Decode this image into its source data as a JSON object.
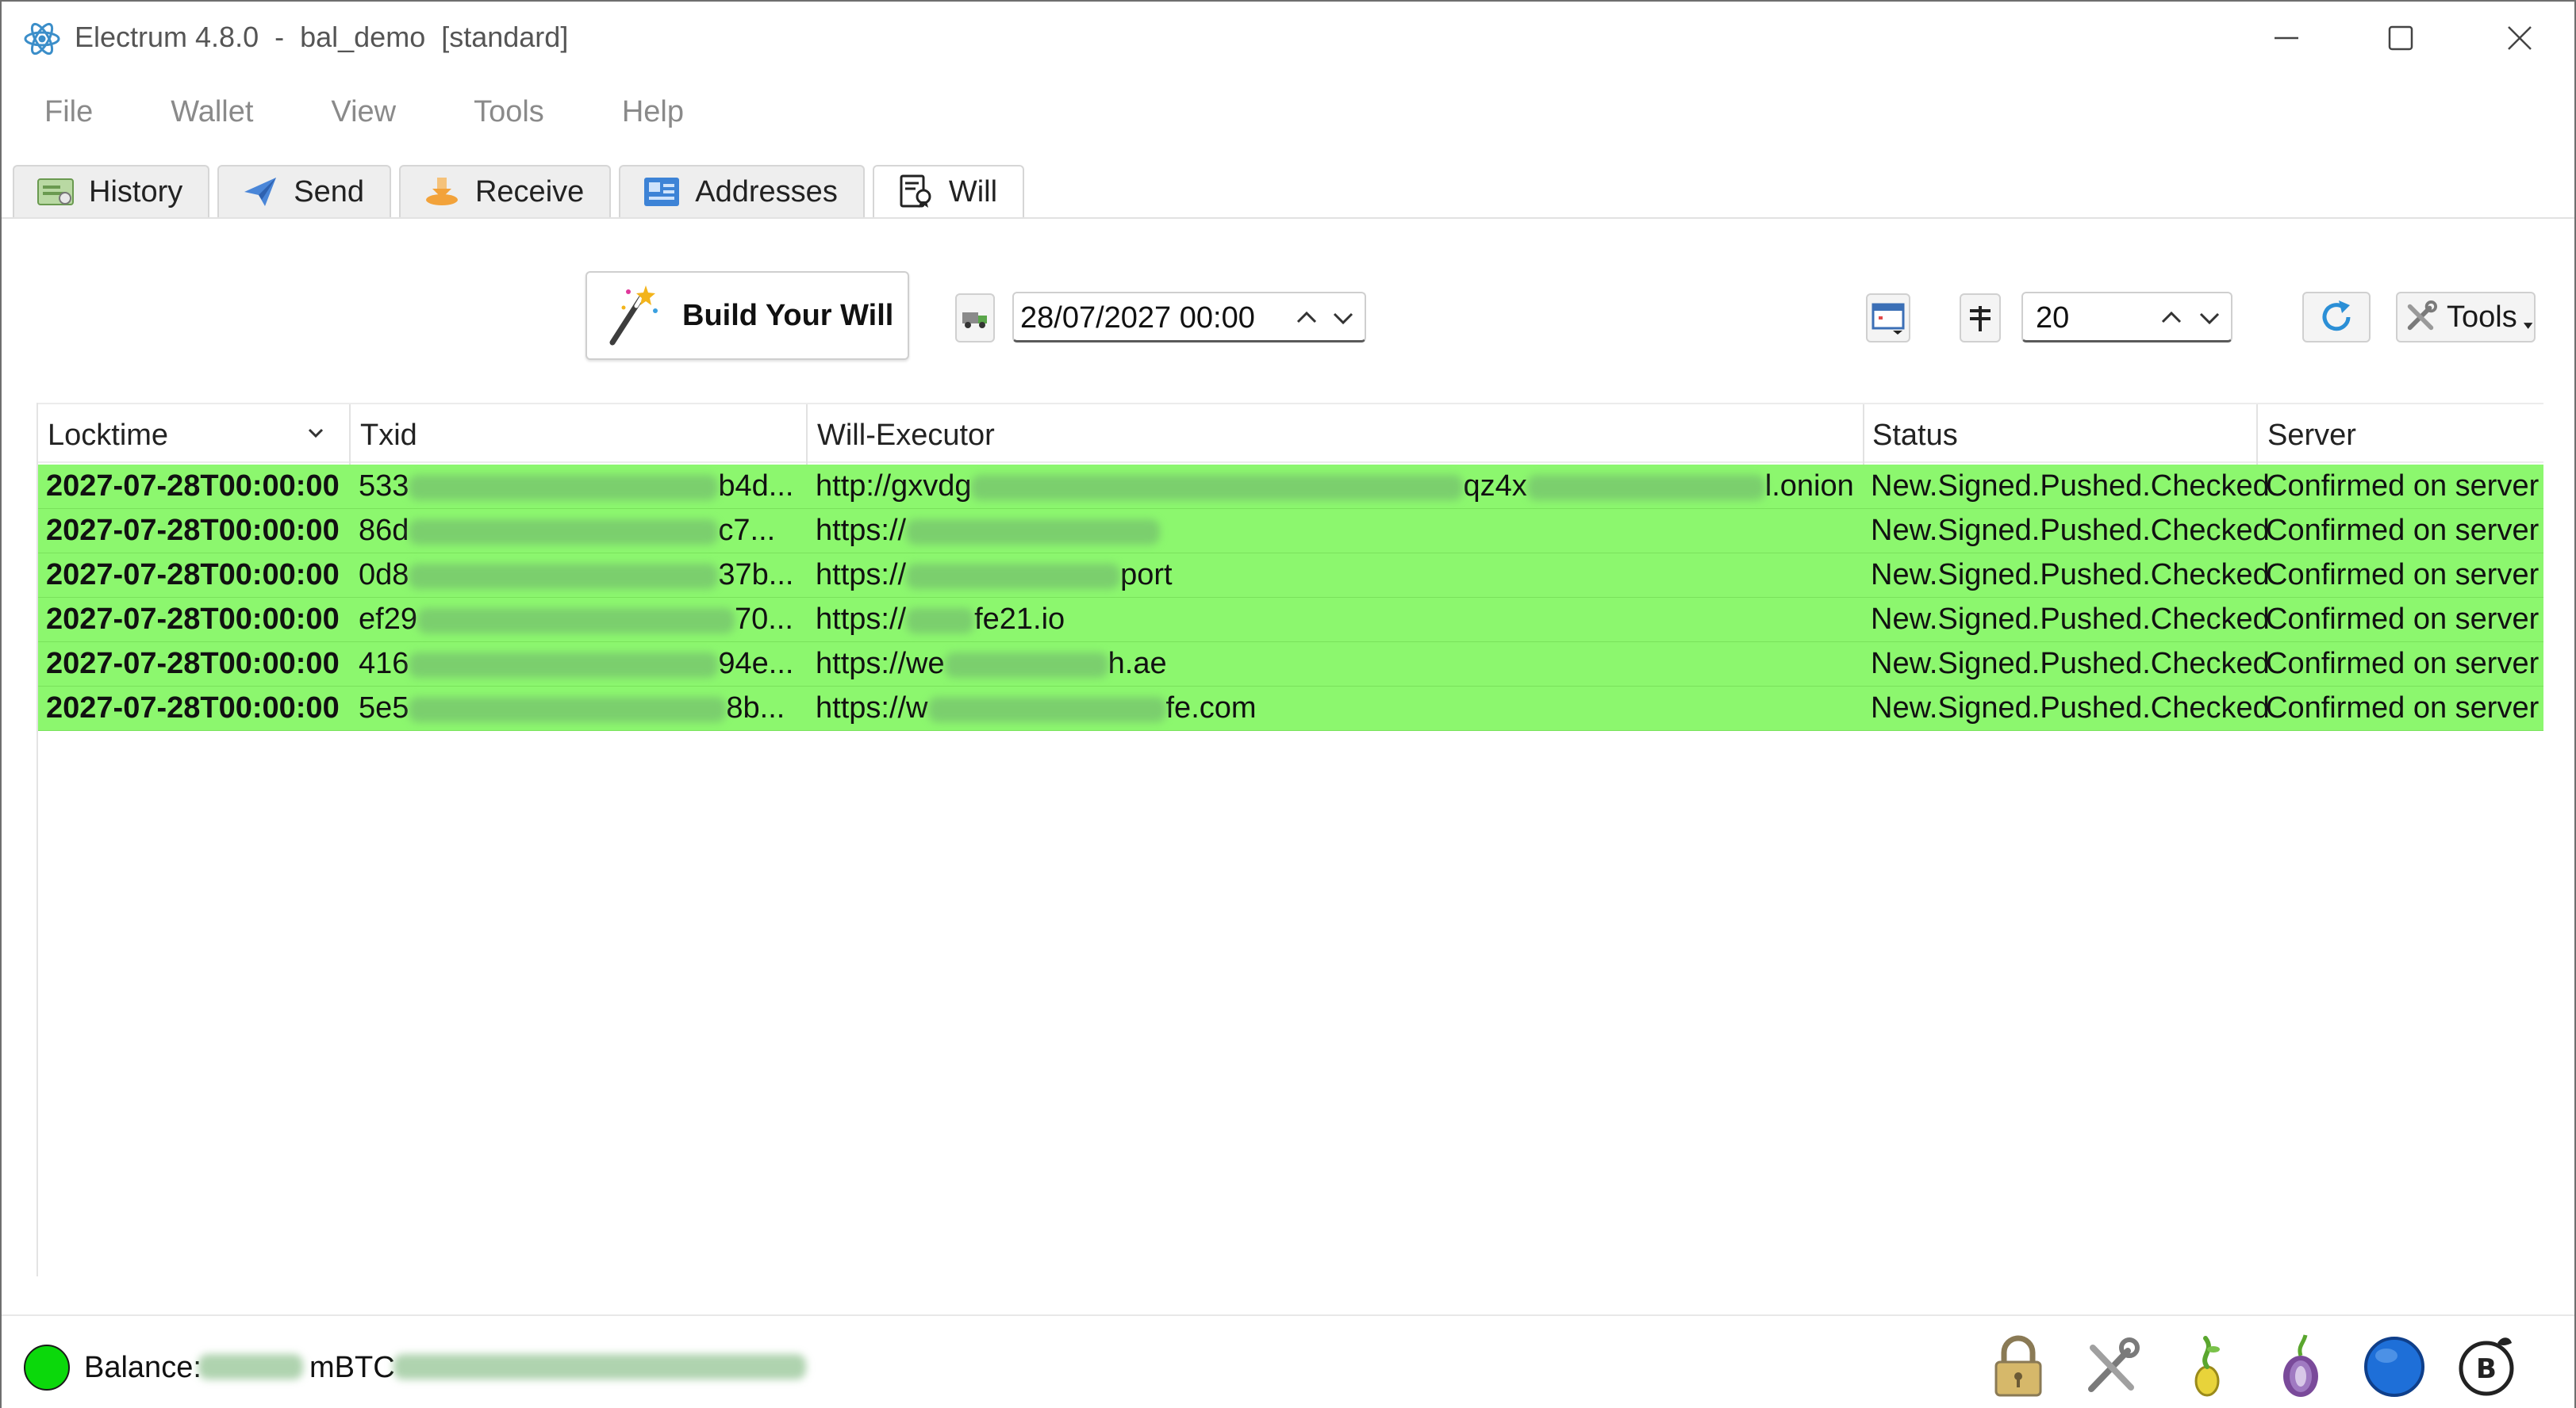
{
  "window": {
    "title": "Electrum 4.8.0  -  bal_demo  [standard]",
    "controls": [
      "minimize",
      "maximize",
      "close"
    ]
  },
  "menu": [
    "File",
    "Wallet",
    "View",
    "Tools",
    "Help"
  ],
  "tabs": [
    {
      "label": "History",
      "icon": "history-icon",
      "active": false
    },
    {
      "label": "Send",
      "icon": "send-icon",
      "active": false
    },
    {
      "label": "Receive",
      "icon": "receive-icon",
      "active": false
    },
    {
      "label": "Addresses",
      "icon": "addresses-icon",
      "active": false
    },
    {
      "label": "Will",
      "icon": "will-icon",
      "active": true
    }
  ],
  "toolbar": {
    "build_label": "Build Your Will",
    "locktime_value": "28/07/2027 00:00",
    "threshold_value": "20",
    "tools_label": "Tools"
  },
  "table": {
    "columns": [
      "Locktime",
      "Txid",
      "Will-Executor",
      "Status",
      "Server"
    ],
    "sort_column": "Locktime",
    "row_color": "#8cf76e",
    "rows": [
      {
        "locktime": "2027-07-28T00:00:00",
        "txid_start": "533",
        "txid_end": "b4d...",
        "executor_start": "http://gxvdg",
        "executor_mid": "qz4x",
        "executor_end": "l.onion",
        "status": "New.Signed.Pushed.Checked",
        "server": "Confirmed on server"
      },
      {
        "locktime": "2027-07-28T00:00:00",
        "txid_start": "86d",
        "txid_end": "c7...",
        "executor_start": "https://",
        "executor_mid": "",
        "executor_end": "",
        "status": "New.Signed.Pushed.Checked",
        "server": "Confirmed on server"
      },
      {
        "locktime": "2027-07-28T00:00:00",
        "txid_start": "0d8",
        "txid_end": "37b...",
        "executor_start": "https://",
        "executor_mid": "",
        "executor_end": "port",
        "status": "New.Signed.Pushed.Checked",
        "server": "Confirmed on server"
      },
      {
        "locktime": "2027-07-28T00:00:00",
        "txid_start": "ef29",
        "txid_end": "70...",
        "executor_start": "https://",
        "executor_mid": "",
        "executor_end": "fe21.io",
        "status": "New.Signed.Pushed.Checked",
        "server": "Confirmed on server"
      },
      {
        "locktime": "2027-07-28T00:00:00",
        "txid_start": "416",
        "txid_end": "94e...",
        "executor_start": "https://we",
        "executor_mid": "",
        "executor_end": "h.ae",
        "status": "New.Signed.Pushed.Checked",
        "server": "Confirmed on server"
      },
      {
        "locktime": "2027-07-28T00:00:00",
        "txid_start": "5e5",
        "txid_end": "8b...",
        "executor_start": "https://w",
        "executor_mid": "",
        "executor_end": "fe.com",
        "status": "New.Signed.Pushed.Checked",
        "server": "Confirmed on server"
      }
    ]
  },
  "statusbar": {
    "balance_label": "Balance:",
    "balance_unit": "mBTC",
    "connection_color": "#0bd80b",
    "icons": [
      "lock-icon",
      "preferences-icon",
      "seed-icon",
      "tor-icon",
      "network-icon",
      "bal-plugin-icon"
    ]
  }
}
